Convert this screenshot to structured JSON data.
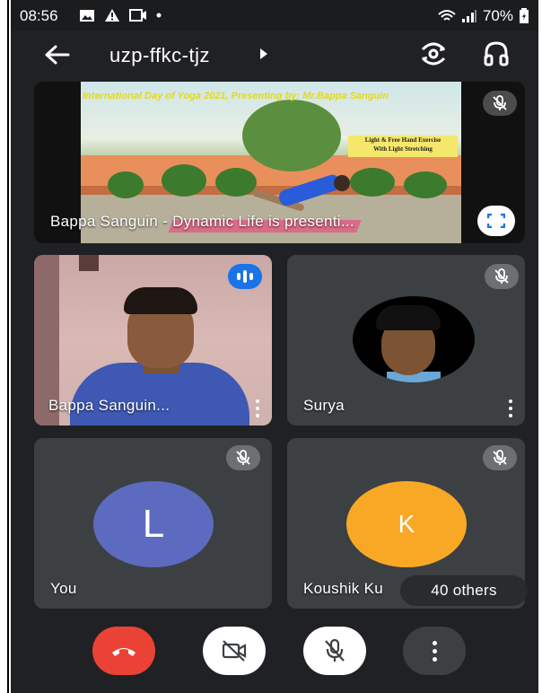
{
  "status_bar": {
    "time": "08:56",
    "battery": "70%",
    "icons": [
      "image-icon",
      "warning-icon",
      "cast-icon",
      "dot-icon",
      "wifi-icon",
      "signal-icon",
      "battery-icon"
    ]
  },
  "app_bar": {
    "meeting_code": "uzp-ffkc-tjz",
    "icons": [
      "back-arrow-icon",
      "caret-right-icon",
      "switch-camera-icon",
      "headphones-icon"
    ]
  },
  "presentation": {
    "slide_title": "International Day of Yoga 2021, Presenting by: Mr.Bappa Sanguin",
    "slide_box_line1": "Light & Free Hand Exercise",
    "slide_box_line2": "With Light Stretching",
    "name": "Bappa Sanguin - Dynamic Life is presenti...",
    "muted": true
  },
  "participants": [
    {
      "name": "Bappa Sanguin...",
      "speaking": true
    },
    {
      "name": "Surya",
      "muted": true
    },
    {
      "name": "You",
      "initial": "L",
      "avatar_color": "#5c6bc0",
      "muted": true
    },
    {
      "name": "Koushik Ku",
      "initial": "K",
      "avatar_color": "#f9a825",
      "muted": true
    }
  ],
  "others_label": "40 others",
  "controls": {
    "end_call_color": "#ea4335",
    "icons": [
      "end-call-icon",
      "camera-off-icon",
      "mic-off-icon",
      "more-options-icon"
    ]
  }
}
